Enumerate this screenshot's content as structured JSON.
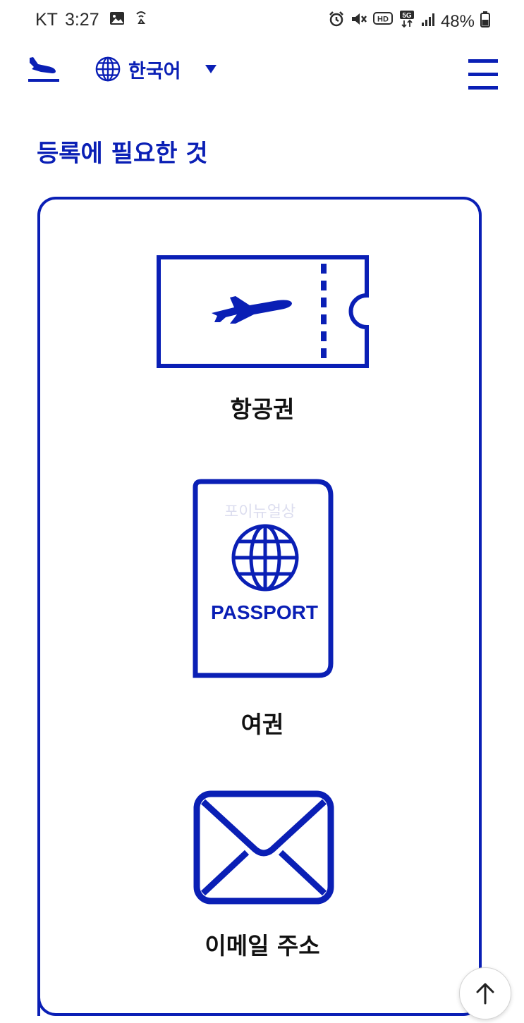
{
  "status_bar": {
    "carrier": "KT",
    "time": "3:27",
    "battery": "48%",
    "icons": [
      "gallery-icon",
      "wifi-calling-icon",
      "alarm-icon",
      "mute-icon",
      "hd-icon",
      "5g-icon",
      "signal-icon",
      "battery-icon"
    ],
    "network_badge": "5G",
    "hd_badge": "HD"
  },
  "header": {
    "logo_icon": "plane-departure-icon",
    "language": "한국어",
    "menu_icon": "hamburger-menu-icon"
  },
  "page": {
    "title": "등록에 필요한 것",
    "items": [
      {
        "label": "항공권",
        "icon": "boarding-pass-icon"
      },
      {
        "label": "여권",
        "icon": "passport-icon",
        "icon_text": "PASSPORT"
      },
      {
        "label": "이메일 주소",
        "icon": "envelope-icon"
      }
    ],
    "watermark": "포이뉴얼상"
  },
  "scroll_top_icon": "arrow-up-icon",
  "colors": {
    "brand": "#0a1fb5",
    "text": "#111111",
    "background": "#ffffff"
  }
}
